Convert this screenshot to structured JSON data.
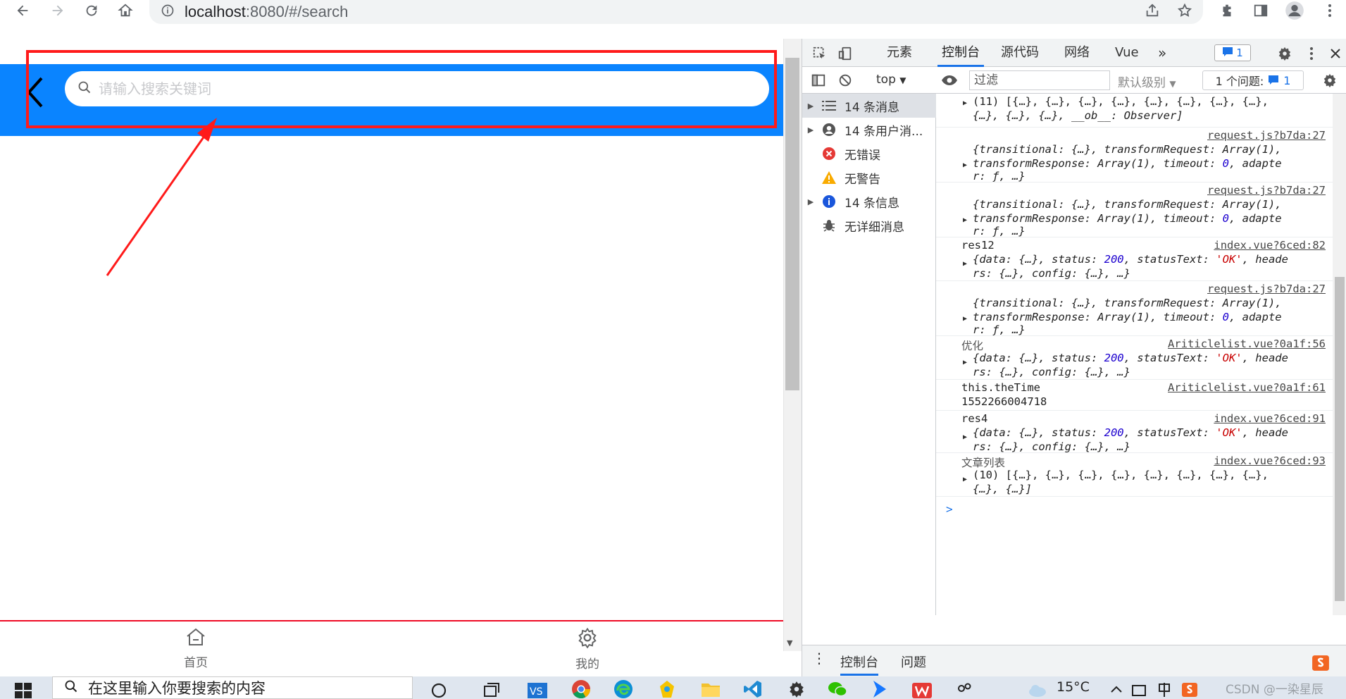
{
  "browser": {
    "url_host": "localhost",
    "url_rest": ":8080/#/search"
  },
  "app": {
    "search_placeholder": "请输入搜索关键词",
    "tabs": [
      {
        "label": "首页",
        "icon": "home-icon"
      },
      {
        "label": "我的",
        "icon": "gear-icon"
      }
    ]
  },
  "devtools": {
    "tabs": [
      "元素",
      "控制台",
      "源代码",
      "网络",
      "Vue"
    ],
    "active_tab": "控制台",
    "badge_count": "1",
    "context": "top",
    "filter_placeholder": "过滤",
    "levels_label": "默认级别",
    "issues_label": "1 个问题:",
    "issues_count": "1",
    "sidebar": [
      {
        "label": "14 条消息",
        "icon": "list-icon",
        "expandable": true
      },
      {
        "label": "14 条用户消...",
        "icon": "user-icon",
        "expandable": true
      },
      {
        "label": "无错误",
        "icon": "error-icon",
        "expandable": false
      },
      {
        "label": "无警告",
        "icon": "warning-icon",
        "expandable": false
      },
      {
        "label": "14 条信息",
        "icon": "info-icon",
        "expandable": true
      },
      {
        "label": "无详细消息",
        "icon": "bug-icon",
        "expandable": false
      }
    ],
    "messages": {
      "m0": {
        "line1": "(11) [{…}, {…}, {…}, {…}, {…}, {…}, {…}, {…},",
        "line2": "{…}, {…}, {…}, __ob__: Observer]"
      },
      "m1": {
        "src": "request.js?b7da:27",
        "line1": "{transitional: {…}, transformRequest: Array(1),",
        "line2": "transformResponse: Array(1), timeout: 0, adapte",
        "line3": "r: ƒ, …}"
      },
      "m2": {
        "src": "request.js?b7da:27",
        "line1": "{transitional: {…}, transformRequest: Array(1),",
        "line2": "transformResponse: Array(1), timeout: 0, adapte",
        "line3": "r: ƒ, …}"
      },
      "m3": {
        "label": "res12",
        "src": "index.vue?6ced:82",
        "line1": "{data: {…}, status: 200, statusText: 'OK', heade",
        "line2": "rs: {…}, config: {…}, …}"
      },
      "m4": {
        "src": "request.js?b7da:27",
        "line1": "{transitional: {…}, transformRequest: Array(1),",
        "line2": "transformResponse: Array(1), timeout: 0, adapte",
        "line3": "r: ƒ, …}"
      },
      "m5": {
        "label": "优化",
        "src": "Ariticlelist.vue?0a1f:56",
        "line1": "{data: {…}, status: 200, statusText: 'OK', heade",
        "line2": "rs: {…}, config: {…}, …}"
      },
      "m6": {
        "label": "this.theTime",
        "src": "Ariticlelist.vue?0a1f:61",
        "line1": "1552266004718"
      },
      "m7": {
        "label": "res4",
        "src": "index.vue?6ced:91",
        "line1": "{data: {…}, status: 200, statusText: 'OK', heade",
        "line2": "rs: {…}, config: {…}, …}"
      },
      "m8": {
        "label": "文章列表",
        "src": "index.vue?6ced:93",
        "line1": "(10) [{…}, {…}, {…}, {…}, {…}, {…}, {…}, {…},",
        "line2": "{…}, {…}]"
      }
    },
    "drawer_tabs": [
      "控制台",
      "问题"
    ]
  },
  "taskbar": {
    "search_text": "在这里输入你要搜索的内容",
    "temperature": "15°C",
    "watermark": "CSDN @一染星辰"
  },
  "colors": {
    "app_header": "#0a84ff",
    "annotation_red": "#ff1a1a",
    "devtools_accent": "#1a73e8"
  }
}
